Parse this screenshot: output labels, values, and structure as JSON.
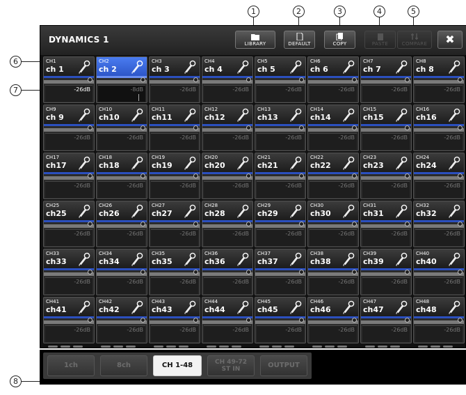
{
  "window": {
    "title": "DYNAMICS 1",
    "toolbar": {
      "library_label": "LIBRARY",
      "default_label": "DEFAULT",
      "copy_label": "COPY",
      "paste_label": "PASTE",
      "compare_label": "COMPARE",
      "close_label": "✖"
    }
  },
  "callouts": [
    "1",
    "2",
    "3",
    "4",
    "5",
    "6",
    "7",
    "8"
  ],
  "channels": [
    {
      "num": "CH1",
      "name": "ch 1",
      "thresh": "-26dB"
    },
    {
      "num": "CH2",
      "name": "ch 2",
      "thresh": "-8dB"
    },
    {
      "num": "CH3",
      "name": "ch 3",
      "thresh": "-26dB"
    },
    {
      "num": "CH4",
      "name": "ch 4",
      "thresh": "-26dB"
    },
    {
      "num": "CH5",
      "name": "ch 5",
      "thresh": "-26dB"
    },
    {
      "num": "CH6",
      "name": "ch 6",
      "thresh": "-26dB"
    },
    {
      "num": "CH7",
      "name": "ch 7",
      "thresh": "-26dB"
    },
    {
      "num": "CH8",
      "name": "ch 8",
      "thresh": "-26dB"
    },
    {
      "num": "CH9",
      "name": "ch 9",
      "thresh": "-26dB"
    },
    {
      "num": "CH10",
      "name": "ch10",
      "thresh": "-26dB"
    },
    {
      "num": "CH11",
      "name": "ch11",
      "thresh": "-26dB"
    },
    {
      "num": "CH12",
      "name": "ch12",
      "thresh": "-26dB"
    },
    {
      "num": "CH13",
      "name": "ch13",
      "thresh": "-26dB"
    },
    {
      "num": "CH14",
      "name": "ch14",
      "thresh": "-26dB"
    },
    {
      "num": "CH15",
      "name": "ch15",
      "thresh": "-26dB"
    },
    {
      "num": "CH16",
      "name": "ch16",
      "thresh": "-26dB"
    },
    {
      "num": "CH17",
      "name": "ch17",
      "thresh": "-26dB"
    },
    {
      "num": "CH18",
      "name": "ch18",
      "thresh": "-26dB"
    },
    {
      "num": "CH19",
      "name": "ch19",
      "thresh": "-26dB"
    },
    {
      "num": "CH20",
      "name": "ch20",
      "thresh": "-26dB"
    },
    {
      "num": "CH21",
      "name": "ch21",
      "thresh": "-26dB"
    },
    {
      "num": "CH22",
      "name": "ch22",
      "thresh": "-26dB"
    },
    {
      "num": "CH23",
      "name": "ch23",
      "thresh": "-26dB"
    },
    {
      "num": "CH24",
      "name": "ch24",
      "thresh": "-26dB"
    },
    {
      "num": "CH25",
      "name": "ch25",
      "thresh": "-26dB"
    },
    {
      "num": "CH26",
      "name": "ch26",
      "thresh": "-26dB"
    },
    {
      "num": "CH27",
      "name": "ch27",
      "thresh": "-26dB"
    },
    {
      "num": "CH28",
      "name": "ch28",
      "thresh": "-26dB"
    },
    {
      "num": "CH29",
      "name": "ch29",
      "thresh": "-26dB"
    },
    {
      "num": "CH30",
      "name": "ch30",
      "thresh": "-26dB"
    },
    {
      "num": "CH31",
      "name": "ch31",
      "thresh": "-26dB"
    },
    {
      "num": "CH32",
      "name": "ch32",
      "thresh": "-26dB"
    },
    {
      "num": "CH33",
      "name": "ch33",
      "thresh": "-26dB"
    },
    {
      "num": "CH34",
      "name": "ch34",
      "thresh": "-26dB"
    },
    {
      "num": "CH35",
      "name": "ch35",
      "thresh": "-26dB"
    },
    {
      "num": "CH36",
      "name": "ch36",
      "thresh": "-26dB"
    },
    {
      "num": "CH37",
      "name": "ch37",
      "thresh": "-26dB"
    },
    {
      "num": "CH38",
      "name": "ch38",
      "thresh": "-26dB"
    },
    {
      "num": "CH39",
      "name": "ch39",
      "thresh": "-26dB"
    },
    {
      "num": "CH40",
      "name": "ch40",
      "thresh": "-26dB"
    },
    {
      "num": "CH41",
      "name": "ch41",
      "thresh": "-26dB"
    },
    {
      "num": "CH42",
      "name": "ch42",
      "thresh": "-26dB"
    },
    {
      "num": "CH43",
      "name": "ch43",
      "thresh": "-26dB"
    },
    {
      "num": "CH44",
      "name": "ch44",
      "thresh": "-26dB"
    },
    {
      "num": "CH45",
      "name": "ch45",
      "thresh": "-26dB"
    },
    {
      "num": "CH46",
      "name": "ch46",
      "thresh": "-26dB"
    },
    {
      "num": "CH47",
      "name": "ch47",
      "thresh": "-26dB"
    },
    {
      "num": "CH48",
      "name": "ch48",
      "thresh": "-26dB"
    }
  ],
  "selected_channel": "CH2",
  "active_channel": "CH1",
  "tabs": [
    {
      "label": "1ch",
      "active": false
    },
    {
      "label": "8ch",
      "active": false
    },
    {
      "label": "CH 1-48",
      "active": true
    },
    {
      "label": "CH 49-72",
      "label2": "ST IN",
      "active": false
    },
    {
      "label": "OUTPUT",
      "active": false
    }
  ],
  "colors": {
    "accent": "#2b4fbe",
    "selected": "#4a7cf0",
    "meter_red": "#e01010"
  }
}
